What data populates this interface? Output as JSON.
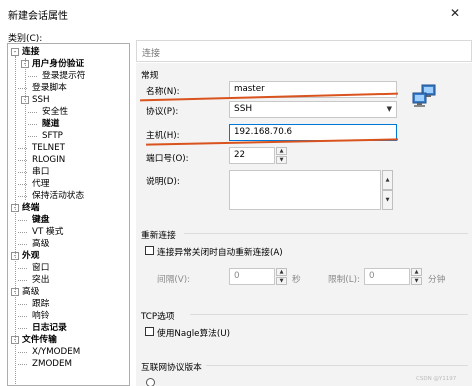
{
  "window": {
    "title": "新建会话属性",
    "close_glyph": "✕"
  },
  "category_label": "类别(C):",
  "tree": [
    {
      "label": "连接",
      "bold": true,
      "expand": "-",
      "level": 0
    },
    {
      "label": "用户身份验证",
      "bold": true,
      "expand": "-",
      "level": 1
    },
    {
      "label": "登录提示符",
      "bold": false,
      "expand": "",
      "level": 2
    },
    {
      "label": "登录脚本",
      "bold": false,
      "expand": "",
      "level": 1
    },
    {
      "label": "SSH",
      "bold": false,
      "expand": "-",
      "level": 1
    },
    {
      "label": "安全性",
      "bold": false,
      "expand": "",
      "level": 2
    },
    {
      "label": "隧道",
      "bold": true,
      "expand": "",
      "level": 2
    },
    {
      "label": "SFTP",
      "bold": false,
      "expand": "",
      "level": 2
    },
    {
      "label": "TELNET",
      "bold": false,
      "expand": "",
      "level": 1
    },
    {
      "label": "RLOGIN",
      "bold": false,
      "expand": "",
      "level": 1
    },
    {
      "label": "串口",
      "bold": false,
      "expand": "",
      "level": 1
    },
    {
      "label": "代理",
      "bold": false,
      "expand": "",
      "level": 1
    },
    {
      "label": "保持活动状态",
      "bold": false,
      "expand": "",
      "level": 1
    },
    {
      "label": "终端",
      "bold": true,
      "expand": "-",
      "level": 0
    },
    {
      "label": "键盘",
      "bold": true,
      "expand": "",
      "level": 1
    },
    {
      "label": "VT 模式",
      "bold": false,
      "expand": "",
      "level": 1
    },
    {
      "label": "高级",
      "bold": false,
      "expand": "",
      "level": 1
    },
    {
      "label": "外观",
      "bold": true,
      "expand": "-",
      "level": 0
    },
    {
      "label": "窗口",
      "bold": false,
      "expand": "",
      "level": 1
    },
    {
      "label": "突出",
      "bold": false,
      "expand": "",
      "level": 1
    },
    {
      "label": "高级",
      "bold": false,
      "expand": "-",
      "level": 0
    },
    {
      "label": "跟踪",
      "bold": false,
      "expand": "",
      "level": 1
    },
    {
      "label": "响铃",
      "bold": false,
      "expand": "",
      "level": 1
    },
    {
      "label": "日志记录",
      "bold": true,
      "expand": "",
      "level": 1
    },
    {
      "label": "文件传输",
      "bold": true,
      "expand": "-",
      "level": 0
    },
    {
      "label": "X/YMODEM",
      "bold": false,
      "expand": "",
      "level": 1
    },
    {
      "label": "ZMODEM",
      "bold": false,
      "expand": "",
      "level": 1
    }
  ],
  "header": {
    "section": "连接"
  },
  "general": {
    "group_title": "常规",
    "name_label": "名称(N):",
    "name_value": "master",
    "protocol_label": "协议(P):",
    "protocol_value": "SSH",
    "host_label": "主机(H):",
    "host_value": "192.168.70.6",
    "port_label": "端口号(O):",
    "port_value": "22",
    "desc_label": "说明(D):",
    "desc_value": ""
  },
  "reconnect": {
    "group_title": "重新连接",
    "checkbox_label": "连接异常关闭时自动重新连接(A)",
    "interval_label": "间隔(V):",
    "interval_value": "0",
    "interval_unit": "秒",
    "limit_label": "限制(L):",
    "limit_value": "0",
    "limit_unit": "分钟"
  },
  "tcp": {
    "group_title": "TCP选项",
    "nagle_label": "使用Nagle算法(U)"
  },
  "ipver": {
    "group_title": "互联网协议版本"
  },
  "watermark": "CSDN @Y1197",
  "colors": {
    "annotation": "#d9531e",
    "focus": "#0078d7"
  }
}
